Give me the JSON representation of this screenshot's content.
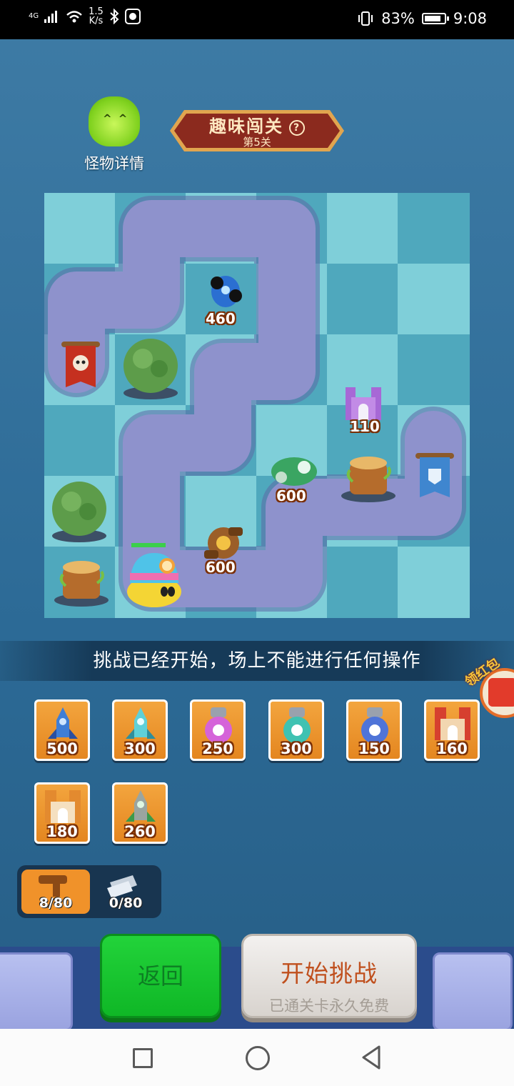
{
  "status_bar": {
    "network": "4G",
    "speed_value": "1.5",
    "speed_unit": "K/s",
    "battery": "83%",
    "time": "9:08"
  },
  "monster": {
    "label": "怪物详情"
  },
  "level": {
    "title": "趣味闯关",
    "help": "?",
    "subtitle": "第5关"
  },
  "board": {
    "pieces": [
      {
        "name": "blue-robot",
        "cost": "460"
      },
      {
        "name": "red-skull-flag"
      },
      {
        "name": "bush-1"
      },
      {
        "name": "purple-castle",
        "cost": "110"
      },
      {
        "name": "green-mech",
        "cost": "600"
      },
      {
        "name": "tree-stump-1"
      },
      {
        "name": "blue-shield-flag"
      },
      {
        "name": "bush-2"
      },
      {
        "name": "bronze-cannon",
        "cost": "600"
      },
      {
        "name": "tree-stump-2"
      },
      {
        "name": "helmet-slime-monster"
      }
    ]
  },
  "notice": "挑战已经开始，场上不能进行任何操作",
  "red_packet": {
    "label": "领红包"
  },
  "towers": [
    {
      "price": "500",
      "icon": "blue-rocket-tower"
    },
    {
      "price": "300",
      "icon": "cyan-rocket-tower"
    },
    {
      "price": "250",
      "icon": "pink-bottle-tower"
    },
    {
      "price": "300",
      "icon": "teal-bottle-tower"
    },
    {
      "price": "150",
      "icon": "blue-bottle-tower"
    },
    {
      "price": "160",
      "icon": "red-castle-tower"
    },
    {
      "price": "180",
      "icon": "orange-castle-tower"
    },
    {
      "price": "260",
      "icon": "green-rocket-tower"
    }
  ],
  "resources": {
    "hammer": "8/80",
    "ticket": "0/80"
  },
  "buttons": {
    "return": "返回",
    "start_title": "开始挑战",
    "start_sub": "已通关卡永久免费"
  },
  "colors": {
    "path": "#8e92cc",
    "tile_light": "#7fcfd9",
    "tile_dark": "#4fa8bd",
    "return_green": "#13c02c",
    "cost_orange": "#f0922a"
  }
}
